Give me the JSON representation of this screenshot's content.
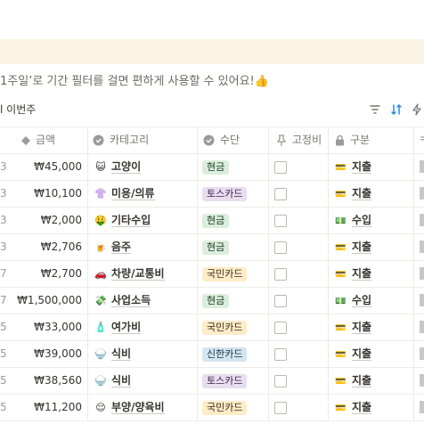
{
  "tip": {
    "text": "1주일’로 기간 필터를 걸면 편하게 사용할 수 있어요!👍"
  },
  "view": {
    "label": "l 이번주"
  },
  "toolbar": {
    "filter_icon": "filter-icon",
    "sort_icon": "sort-icon",
    "automation_icon": "lightning-icon"
  },
  "columns": {
    "amount": "금액",
    "category": "카테고리",
    "payment": "수단",
    "fixed": "고정비",
    "kind": "구분",
    "extra": "ㅋ"
  },
  "tag_colors": {
    "현금": {
      "bg": "#dbeddb",
      "fg": "#1c3829"
    },
    "토스카드": {
      "bg": "#e8deee",
      "fg": "#412454"
    },
    "국민카드": {
      "bg": "#fdecc8",
      "fg": "#402c1b"
    },
    "신한카드": {
      "bg": "#d3e5ef",
      "fg": "#183347"
    }
  },
  "rows": [
    {
      "edge": "3",
      "amount": "₩45,000",
      "cat_emoji": "😺",
      "category": "고양이",
      "payment": "현금",
      "kind_emoji": "💳",
      "kind": "지출"
    },
    {
      "edge": "3",
      "amount": "₩10,100",
      "cat_emoji": "👚",
      "category": "미용/의류",
      "payment": "토스카드",
      "kind_emoji": "💳",
      "kind": "지출"
    },
    {
      "edge": "3",
      "amount": "₩2,000",
      "cat_emoji": "🤑",
      "category": "기타수입",
      "payment": "현금",
      "kind_emoji": "💵",
      "kind": "수입"
    },
    {
      "edge": "3",
      "amount": "₩2,706",
      "cat_emoji": "🍺",
      "category": "음주",
      "payment": "현금",
      "kind_emoji": "💳",
      "kind": "지출"
    },
    {
      "edge": "7",
      "amount": "₩2,700",
      "cat_emoji": "🚗",
      "category": "차량/교통비",
      "payment": "국민카드",
      "kind_emoji": "💳",
      "kind": "지출"
    },
    {
      "edge": "7",
      "amount": "₩1,500,000",
      "cat_emoji": "💸",
      "category": "사업소득",
      "payment": "현금",
      "kind_emoji": "💵",
      "kind": "수입"
    },
    {
      "edge": "5",
      "amount": "₩33,000",
      "cat_emoji": "🧴",
      "category": "여가비",
      "payment": "국민카드",
      "kind_emoji": "💳",
      "kind": "지출"
    },
    {
      "edge": "5",
      "amount": "₩39,000",
      "cat_emoji": "🍚",
      "category": "식비",
      "payment": "신한카드",
      "kind_emoji": "💳",
      "kind": "지출"
    },
    {
      "edge": "5",
      "amount": "₩38,560",
      "cat_emoji": "🍚",
      "category": "식비",
      "payment": "토스카드",
      "kind_emoji": "💳",
      "kind": "지출"
    },
    {
      "edge": "5",
      "amount": "₩11,200",
      "cat_emoji": "😌",
      "category": "부양/양육비",
      "payment": "국민카드",
      "kind_emoji": "💳",
      "kind": "지출"
    }
  ]
}
